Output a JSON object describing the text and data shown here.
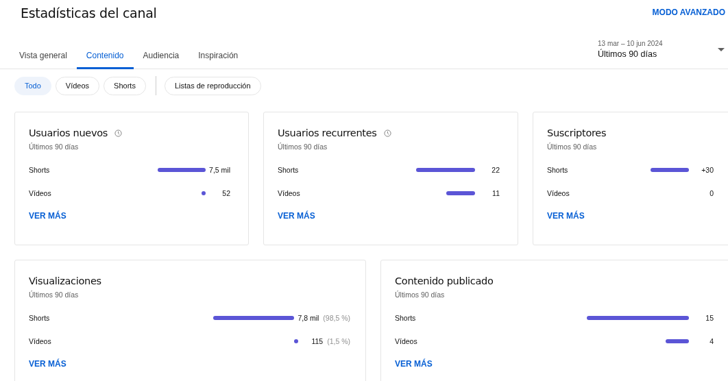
{
  "page": {
    "title": "Estadísticas del canal",
    "advanced_link": "MODO AVANZADO"
  },
  "tabs": [
    {
      "label": "Vista general",
      "selected": false
    },
    {
      "label": "Contenido",
      "selected": true
    },
    {
      "label": "Audiencia",
      "selected": false
    },
    {
      "label": "Inspiración",
      "selected": false
    }
  ],
  "date_range": {
    "dates": "13 mar – 10 jun 2024",
    "label": "Últimos 90 días"
  },
  "filters": [
    {
      "label": "Todo",
      "selected": true
    },
    {
      "label": "Vídeos",
      "selected": false
    },
    {
      "label": "Shorts",
      "selected": false
    }
  ],
  "playlist_filter": {
    "label": "Listas de reproducción",
    "selected": false
  },
  "card_rows": [
    [
      {
        "title": "Usuarios nuevos",
        "clock_icon": true,
        "period": "Últimos 90 días",
        "link": "VER MÁS",
        "metrics": [
          {
            "label": "Shorts",
            "value": "7,5 mil"
          },
          {
            "label": "Vídeos",
            "value": "52"
          }
        ]
      },
      {
        "title": "Usuarios recurrentes",
        "clock_icon": true,
        "period": "Últimos 90 días",
        "link": "VER MÁS",
        "metrics": [
          {
            "label": "Shorts",
            "value": "22"
          },
          {
            "label": "Vídeos",
            "value": "11"
          }
        ]
      },
      {
        "title": "Suscriptores",
        "clock_icon": false,
        "period": "Últimos 90 días",
        "link": "VER MÁS",
        "metrics": [
          {
            "label": "Shorts",
            "value": "+30"
          },
          {
            "label": "Vídeos",
            "value": "0"
          }
        ]
      }
    ],
    [
      {
        "title": "Visualizaciones",
        "clock_icon": false,
        "period": "Últimos 90 días",
        "link": "VER MÁS",
        "metrics": [
          {
            "label": "Shorts",
            "value": "7,8 mil",
            "share": "(98,5 %)"
          },
          {
            "label": "Vídeos",
            "value": "115",
            "share": "(1,5 %)"
          }
        ]
      },
      {
        "title": "Contenido publicado",
        "clock_icon": false,
        "period": "Últimos 90 días",
        "link": "VER MÁS",
        "metrics": [
          {
            "label": "Shorts",
            "value": "15"
          },
          {
            "label": "Vídeos",
            "value": "4"
          }
        ]
      }
    ]
  ]
}
